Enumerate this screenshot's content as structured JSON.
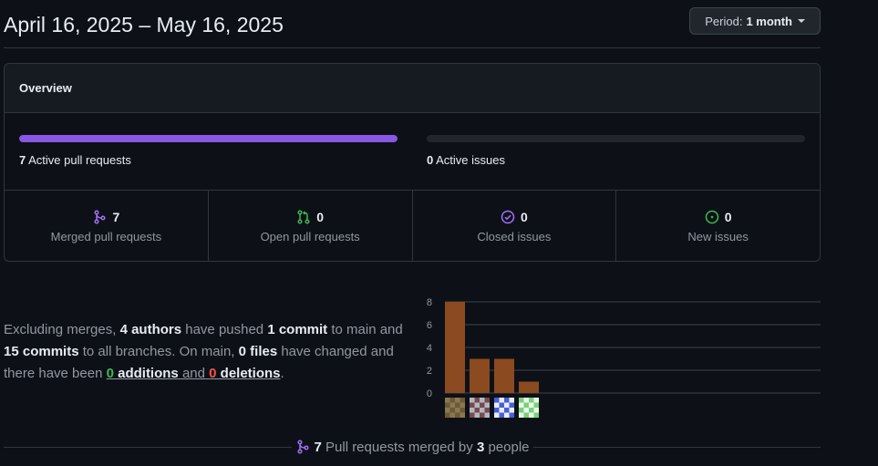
{
  "header": {
    "date_range": "April 16, 2025 – May 16, 2025",
    "period_prefix": "Period:",
    "period_value": "1 month"
  },
  "overview": {
    "title": "Overview",
    "pr_bar": {
      "count": "7",
      "label": "Active pull requests",
      "fill_fraction": 1.0
    },
    "issue_bar": {
      "count": "0",
      "label": "Active issues",
      "fill_fraction": 0.0
    },
    "stats": [
      {
        "icon": "git-merge-icon",
        "value": "7",
        "label": "Merged pull requests",
        "color": "#a371f7"
      },
      {
        "icon": "git-pull-request-icon",
        "value": "0",
        "label": "Open pull requests",
        "color": "#3fb950"
      },
      {
        "icon": "issue-closed-icon",
        "value": "0",
        "label": "Closed issues",
        "color": "#a371f7"
      },
      {
        "icon": "issue-opened-icon",
        "value": "0",
        "label": "New issues",
        "color": "#3fb950"
      }
    ]
  },
  "summary": {
    "t1": "Excluding merges, ",
    "authors": "4 authors",
    "t2": " have pushed ",
    "commit": "1 commit",
    "t3": " to main and ",
    "commits": "15 commits",
    "t4": " to all branches. On main, ",
    "files": "0 files",
    "t5": " have changed and there have been ",
    "additions_n": "0",
    "additions_w": " additions",
    "t6": " and ",
    "deletions_n": "0",
    "deletions_w": " deletions",
    "t7": "."
  },
  "chart_data": {
    "type": "bar",
    "categories": [
      "author-1",
      "author-2",
      "author-3",
      "author-4"
    ],
    "values": [
      8,
      3,
      3,
      1
    ],
    "y_ticks": [
      "0",
      "2",
      "4",
      "6",
      "8"
    ],
    "ylim": [
      0,
      8
    ],
    "bar_color": "#8b4a1f",
    "grid": true
  },
  "footer": {
    "count": "7",
    "t1": " Pull requests merged by ",
    "people": "3",
    "t2": " people"
  }
}
